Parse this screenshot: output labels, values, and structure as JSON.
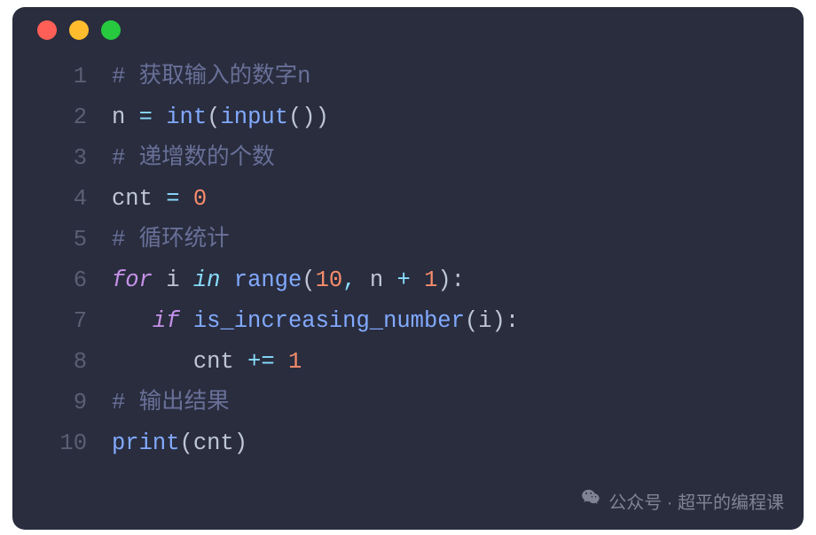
{
  "window": {
    "traffic_lights": [
      "red",
      "yellow",
      "green"
    ]
  },
  "code": {
    "lines": [
      {
        "n": "1",
        "tokens": [
          {
            "c": "tok-comment",
            "t": "# 获取输入的数字n"
          }
        ]
      },
      {
        "n": "2",
        "tokens": [
          {
            "c": "tok-ident",
            "t": "n "
          },
          {
            "c": "tok-op",
            "t": "="
          },
          {
            "c": "tok-ident",
            "t": " "
          },
          {
            "c": "tok-builtin",
            "t": "int"
          },
          {
            "c": "tok-punct",
            "t": "("
          },
          {
            "c": "tok-builtin",
            "t": "input"
          },
          {
            "c": "tok-punct",
            "t": "())"
          }
        ]
      },
      {
        "n": "3",
        "tokens": [
          {
            "c": "tok-comment",
            "t": "# 递增数的个数"
          }
        ]
      },
      {
        "n": "4",
        "tokens": [
          {
            "c": "tok-ident",
            "t": "cnt "
          },
          {
            "c": "tok-op",
            "t": "="
          },
          {
            "c": "tok-ident",
            "t": " "
          },
          {
            "c": "tok-number",
            "t": "0"
          }
        ]
      },
      {
        "n": "5",
        "tokens": [
          {
            "c": "tok-comment",
            "t": "# 循环统计"
          }
        ]
      },
      {
        "n": "6",
        "tokens": [
          {
            "c": "tok-keyword",
            "t": "for"
          },
          {
            "c": "tok-ident",
            "t": " i "
          },
          {
            "c": "tok-keyword2",
            "t": "in"
          },
          {
            "c": "tok-ident",
            "t": " "
          },
          {
            "c": "tok-builtin",
            "t": "range"
          },
          {
            "c": "tok-punct",
            "t": "("
          },
          {
            "c": "tok-number",
            "t": "10"
          },
          {
            "c": "tok-op",
            "t": ","
          },
          {
            "c": "tok-ident",
            "t": " n "
          },
          {
            "c": "tok-op",
            "t": "+"
          },
          {
            "c": "tok-ident",
            "t": " "
          },
          {
            "c": "tok-number",
            "t": "1"
          },
          {
            "c": "tok-punct",
            "t": "):"
          }
        ]
      },
      {
        "n": "7",
        "tokens": [
          {
            "c": "tok-ident",
            "t": "   "
          },
          {
            "c": "tok-keyword",
            "t": "if"
          },
          {
            "c": "tok-ident",
            "t": " "
          },
          {
            "c": "tok-builtin",
            "t": "is_increasing_number"
          },
          {
            "c": "tok-punct",
            "t": "(i):"
          }
        ]
      },
      {
        "n": "8",
        "tokens": [
          {
            "c": "tok-ident",
            "t": "      cnt "
          },
          {
            "c": "tok-op",
            "t": "+="
          },
          {
            "c": "tok-ident",
            "t": " "
          },
          {
            "c": "tok-number",
            "t": "1"
          }
        ]
      },
      {
        "n": "9",
        "tokens": [
          {
            "c": "tok-comment",
            "t": "# 输出结果"
          }
        ]
      },
      {
        "n": "10",
        "tokens": [
          {
            "c": "tok-builtin",
            "t": "print"
          },
          {
            "c": "tok-punct",
            "t": "(cnt)"
          }
        ]
      }
    ]
  },
  "watermark": {
    "text": "公众号 · 超平的编程课"
  }
}
